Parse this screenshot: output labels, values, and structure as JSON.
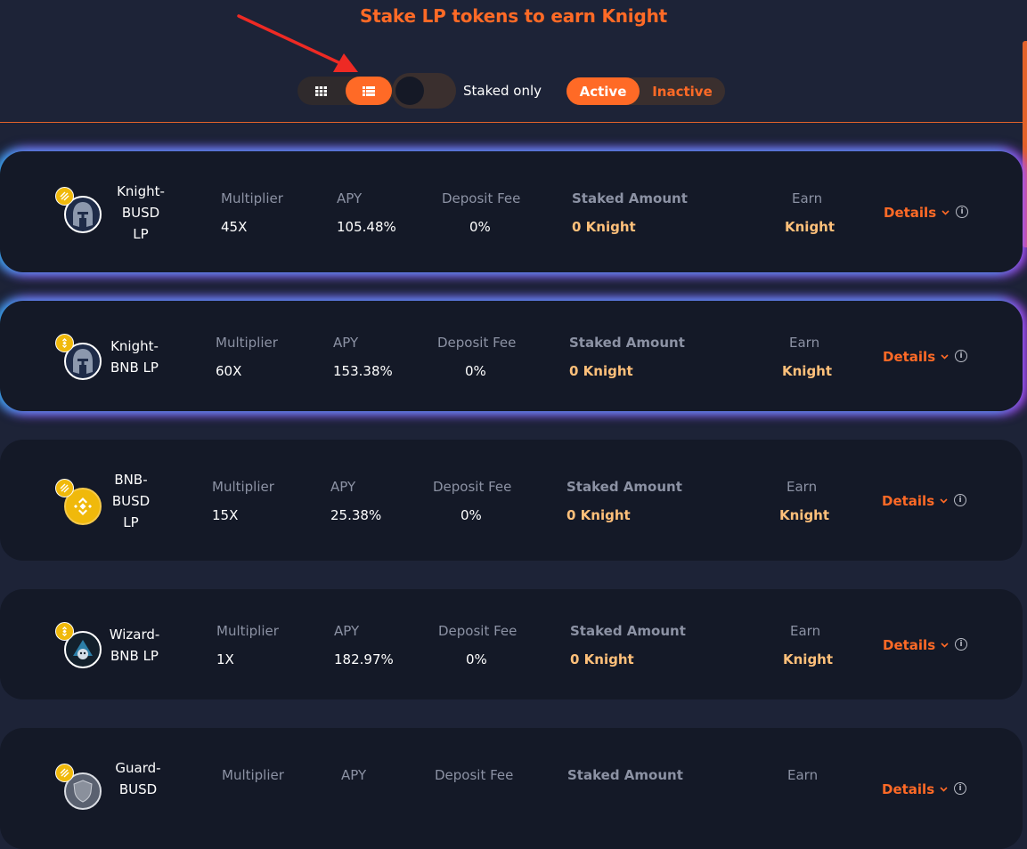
{
  "header": {
    "title": "Stake LP tokens to earn Knight",
    "view_toggle": {
      "grid_icon": "grid-icon",
      "list_icon": "list-icon",
      "selected": "list"
    },
    "staked_only_label": "Staked only",
    "staked_only_on": false,
    "status_tabs": {
      "active": "Active",
      "inactive": "Inactive",
      "selected": "Active"
    }
  },
  "colors": {
    "accent": "#ff6a26",
    "page_bg": "#1d2337",
    "row_bg": "#141927",
    "earn_value": "#ffc07a"
  },
  "columns": {
    "multiplier": "Multiplier",
    "apy": "APY",
    "deposit_fee": "Deposit Fee",
    "staked_amount": "Staked Amount",
    "earn": "Earn"
  },
  "details_label": "Details",
  "farms": [
    {
      "name_lines": [
        "Knight-",
        "BUSD",
        "LP"
      ],
      "token_icon": "knight-helmet-icon",
      "quote_icon": "busd-icon",
      "multiplier": "45X",
      "apy": "105.48%",
      "deposit_fee": "0%",
      "staked_amount": "0 Knight",
      "earn": "Knight",
      "highlighted": true
    },
    {
      "name_lines": [
        "Knight-",
        "BNB LP"
      ],
      "token_icon": "knight-helmet-icon",
      "quote_icon": "bnb-icon",
      "multiplier": "60X",
      "apy": "153.38%",
      "deposit_fee": "0%",
      "staked_amount": "0 Knight",
      "earn": "Knight",
      "highlighted": true
    },
    {
      "name_lines": [
        "BNB-",
        "BUSD",
        "LP"
      ],
      "token_icon": "bnb-icon",
      "quote_icon": "busd-icon",
      "multiplier": "15X",
      "apy": "25.38%",
      "deposit_fee": "0%",
      "staked_amount": "0 Knight",
      "earn": "Knight",
      "highlighted": false
    },
    {
      "name_lines": [
        "Wizard-",
        "BNB LP"
      ],
      "token_icon": "wizard-icon",
      "quote_icon": "bnb-icon",
      "multiplier": "1X",
      "apy": "182.97%",
      "deposit_fee": "0%",
      "staked_amount": "0 Knight",
      "earn": "Knight",
      "highlighted": false
    },
    {
      "name_lines": [
        "Guard-",
        "BUSD"
      ],
      "token_icon": "guard-shield-icon",
      "quote_icon": "busd-icon",
      "multiplier": "",
      "apy": "",
      "deposit_fee": "",
      "staked_amount": "",
      "earn": "",
      "highlighted": false
    }
  ]
}
